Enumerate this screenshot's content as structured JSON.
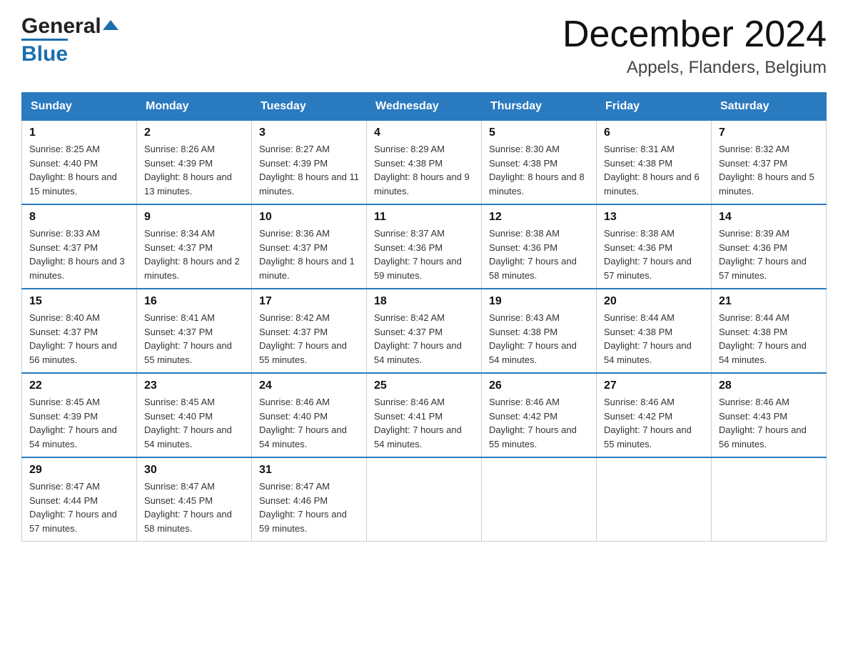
{
  "header": {
    "logo_general": "General",
    "logo_blue": "Blue",
    "month_title": "December 2024",
    "location": "Appels, Flanders, Belgium"
  },
  "calendar": {
    "days_of_week": [
      "Sunday",
      "Monday",
      "Tuesday",
      "Wednesday",
      "Thursday",
      "Friday",
      "Saturday"
    ],
    "weeks": [
      [
        {
          "day": "1",
          "sunrise": "8:25 AM",
          "sunset": "4:40 PM",
          "daylight": "8 hours and 15 minutes."
        },
        {
          "day": "2",
          "sunrise": "8:26 AM",
          "sunset": "4:39 PM",
          "daylight": "8 hours and 13 minutes."
        },
        {
          "day": "3",
          "sunrise": "8:27 AM",
          "sunset": "4:39 PM",
          "daylight": "8 hours and 11 minutes."
        },
        {
          "day": "4",
          "sunrise": "8:29 AM",
          "sunset": "4:38 PM",
          "daylight": "8 hours and 9 minutes."
        },
        {
          "day": "5",
          "sunrise": "8:30 AM",
          "sunset": "4:38 PM",
          "daylight": "8 hours and 8 minutes."
        },
        {
          "day": "6",
          "sunrise": "8:31 AM",
          "sunset": "4:38 PM",
          "daylight": "8 hours and 6 minutes."
        },
        {
          "day": "7",
          "sunrise": "8:32 AM",
          "sunset": "4:37 PM",
          "daylight": "8 hours and 5 minutes."
        }
      ],
      [
        {
          "day": "8",
          "sunrise": "8:33 AM",
          "sunset": "4:37 PM",
          "daylight": "8 hours and 3 minutes."
        },
        {
          "day": "9",
          "sunrise": "8:34 AM",
          "sunset": "4:37 PM",
          "daylight": "8 hours and 2 minutes."
        },
        {
          "day": "10",
          "sunrise": "8:36 AM",
          "sunset": "4:37 PM",
          "daylight": "8 hours and 1 minute."
        },
        {
          "day": "11",
          "sunrise": "8:37 AM",
          "sunset": "4:36 PM",
          "daylight": "7 hours and 59 minutes."
        },
        {
          "day": "12",
          "sunrise": "8:38 AM",
          "sunset": "4:36 PM",
          "daylight": "7 hours and 58 minutes."
        },
        {
          "day": "13",
          "sunrise": "8:38 AM",
          "sunset": "4:36 PM",
          "daylight": "7 hours and 57 minutes."
        },
        {
          "day": "14",
          "sunrise": "8:39 AM",
          "sunset": "4:36 PM",
          "daylight": "7 hours and 57 minutes."
        }
      ],
      [
        {
          "day": "15",
          "sunrise": "8:40 AM",
          "sunset": "4:37 PM",
          "daylight": "7 hours and 56 minutes."
        },
        {
          "day": "16",
          "sunrise": "8:41 AM",
          "sunset": "4:37 PM",
          "daylight": "7 hours and 55 minutes."
        },
        {
          "day": "17",
          "sunrise": "8:42 AM",
          "sunset": "4:37 PM",
          "daylight": "7 hours and 55 minutes."
        },
        {
          "day": "18",
          "sunrise": "8:42 AM",
          "sunset": "4:37 PM",
          "daylight": "7 hours and 54 minutes."
        },
        {
          "day": "19",
          "sunrise": "8:43 AM",
          "sunset": "4:38 PM",
          "daylight": "7 hours and 54 minutes."
        },
        {
          "day": "20",
          "sunrise": "8:44 AM",
          "sunset": "4:38 PM",
          "daylight": "7 hours and 54 minutes."
        },
        {
          "day": "21",
          "sunrise": "8:44 AM",
          "sunset": "4:38 PM",
          "daylight": "7 hours and 54 minutes."
        }
      ],
      [
        {
          "day": "22",
          "sunrise": "8:45 AM",
          "sunset": "4:39 PM",
          "daylight": "7 hours and 54 minutes."
        },
        {
          "day": "23",
          "sunrise": "8:45 AM",
          "sunset": "4:40 PM",
          "daylight": "7 hours and 54 minutes."
        },
        {
          "day": "24",
          "sunrise": "8:46 AM",
          "sunset": "4:40 PM",
          "daylight": "7 hours and 54 minutes."
        },
        {
          "day": "25",
          "sunrise": "8:46 AM",
          "sunset": "4:41 PM",
          "daylight": "7 hours and 54 minutes."
        },
        {
          "day": "26",
          "sunrise": "8:46 AM",
          "sunset": "4:42 PM",
          "daylight": "7 hours and 55 minutes."
        },
        {
          "day": "27",
          "sunrise": "8:46 AM",
          "sunset": "4:42 PM",
          "daylight": "7 hours and 55 minutes."
        },
        {
          "day": "28",
          "sunrise": "8:46 AM",
          "sunset": "4:43 PM",
          "daylight": "7 hours and 56 minutes."
        }
      ],
      [
        {
          "day": "29",
          "sunrise": "8:47 AM",
          "sunset": "4:44 PM",
          "daylight": "7 hours and 57 minutes."
        },
        {
          "day": "30",
          "sunrise": "8:47 AM",
          "sunset": "4:45 PM",
          "daylight": "7 hours and 58 minutes."
        },
        {
          "day": "31",
          "sunrise": "8:47 AM",
          "sunset": "4:46 PM",
          "daylight": "7 hours and 59 minutes."
        },
        null,
        null,
        null,
        null
      ]
    ]
  }
}
